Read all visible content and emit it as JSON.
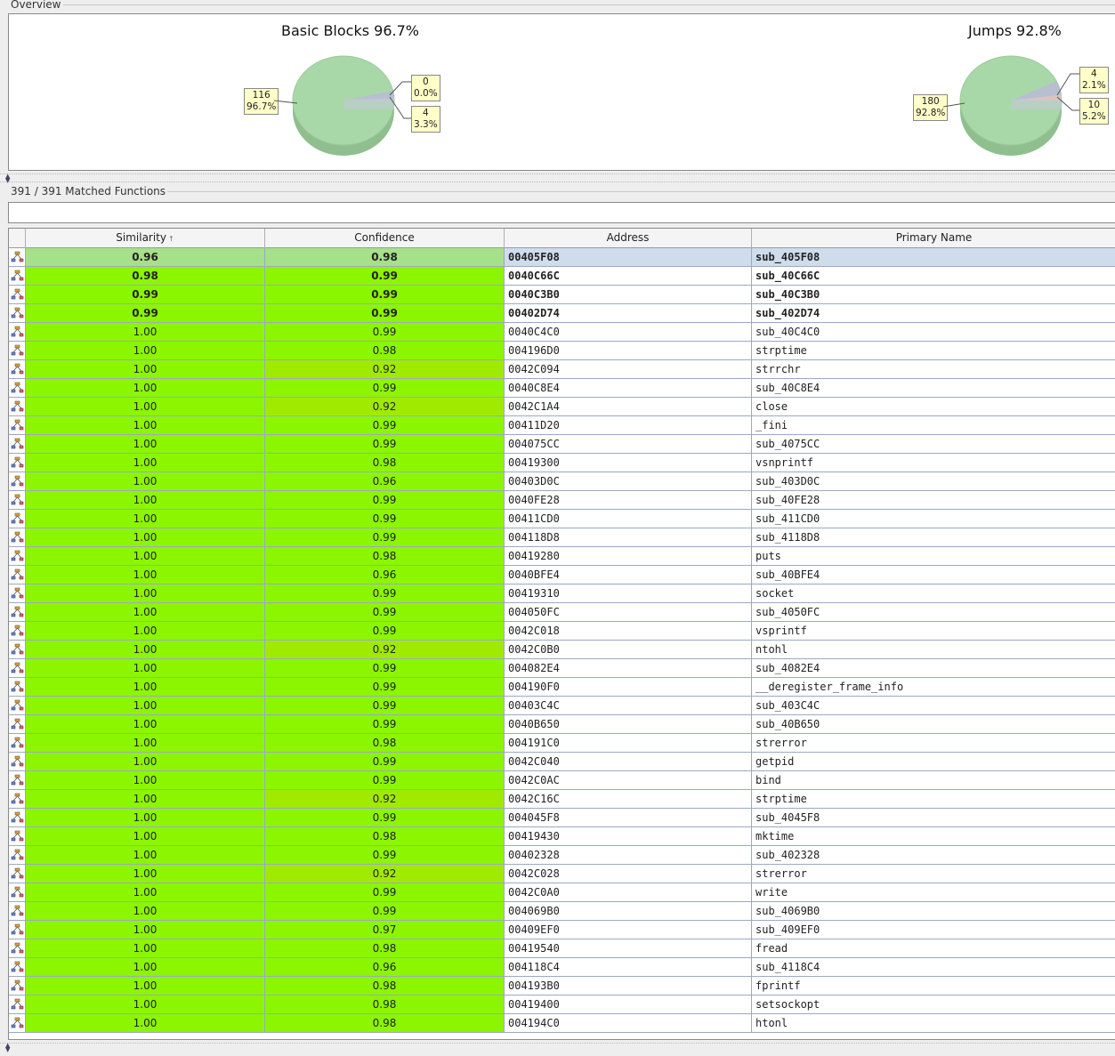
{
  "overview": {
    "title": "Overview",
    "charts": [
      {
        "title": "Basic Blocks 96.7%",
        "slices": [
          {
            "count": "116",
            "pct": "96.7%",
            "value": 116,
            "color": "#a8d8a8"
          },
          {
            "count": "0",
            "pct": "0.0%",
            "value": 0,
            "color": "#e8c8c8"
          },
          {
            "count": "4",
            "pct": "3.3%",
            "value": 4,
            "color": "#b8bcd4"
          }
        ]
      },
      {
        "title": "Jumps 92.8%",
        "slices": [
          {
            "count": "180",
            "pct": "92.8%",
            "value": 180,
            "color": "#a8d8a8"
          },
          {
            "count": "4",
            "pct": "2.1%",
            "value": 4,
            "color": "#e8c0c0"
          },
          {
            "count": "10",
            "pct": "5.2%",
            "value": 10,
            "color": "#b8bcd4"
          }
        ]
      }
    ]
  },
  "matched": {
    "title": "391 / 391 Matched Functions",
    "filter_value": "",
    "columns": {
      "similarity": "Similarity",
      "confidence": "Confidence",
      "address": "Address",
      "primary_name": "Primary Name"
    },
    "sort_indicator": "↑",
    "rows": [
      {
        "similarity": "0.96",
        "confidence": "0.98",
        "address": "00405F08",
        "name": "sub_405F08",
        "bold": true,
        "selected": true
      },
      {
        "similarity": "0.98",
        "confidence": "0.99",
        "address": "0040C66C",
        "name": "sub_40C66C",
        "bold": true
      },
      {
        "similarity": "0.99",
        "confidence": "0.99",
        "address": "0040C3B0",
        "name": "sub_40C3B0",
        "bold": true
      },
      {
        "similarity": "0.99",
        "confidence": "0.99",
        "address": "00402D74",
        "name": "sub_402D74",
        "bold": true
      },
      {
        "similarity": "1.00",
        "confidence": "0.99",
        "address": "0040C4C0",
        "name": "sub_40C4C0"
      },
      {
        "similarity": "1.00",
        "confidence": "0.98",
        "address": "004196D0",
        "name": "strptime"
      },
      {
        "similarity": "1.00",
        "confidence": "0.92",
        "address": "0042C094",
        "name": "strrchr"
      },
      {
        "similarity": "1.00",
        "confidence": "0.99",
        "address": "0040C8E4",
        "name": "sub_40C8E4"
      },
      {
        "similarity": "1.00",
        "confidence": "0.92",
        "address": "0042C1A4",
        "name": "close"
      },
      {
        "similarity": "1.00",
        "confidence": "0.99",
        "address": "00411D20",
        "name": "_fini"
      },
      {
        "similarity": "1.00",
        "confidence": "0.99",
        "address": "004075CC",
        "name": "sub_4075CC"
      },
      {
        "similarity": "1.00",
        "confidence": "0.98",
        "address": "00419300",
        "name": "vsnprintf"
      },
      {
        "similarity": "1.00",
        "confidence": "0.96",
        "address": "00403D0C",
        "name": "sub_403D0C"
      },
      {
        "similarity": "1.00",
        "confidence": "0.99",
        "address": "0040FE28",
        "name": "sub_40FE28"
      },
      {
        "similarity": "1.00",
        "confidence": "0.99",
        "address": "00411CD0",
        "name": "sub_411CD0"
      },
      {
        "similarity": "1.00",
        "confidence": "0.99",
        "address": "004118D8",
        "name": "sub_4118D8"
      },
      {
        "similarity": "1.00",
        "confidence": "0.98",
        "address": "00419280",
        "name": "puts"
      },
      {
        "similarity": "1.00",
        "confidence": "0.96",
        "address": "0040BFE4",
        "name": "sub_40BFE4"
      },
      {
        "similarity": "1.00",
        "confidence": "0.99",
        "address": "00419310",
        "name": "socket"
      },
      {
        "similarity": "1.00",
        "confidence": "0.99",
        "address": "004050FC",
        "name": "sub_4050FC"
      },
      {
        "similarity": "1.00",
        "confidence": "0.99",
        "address": "0042C018",
        "name": "vsprintf"
      },
      {
        "similarity": "1.00",
        "confidence": "0.92",
        "address": "0042C0B0",
        "name": "ntohl"
      },
      {
        "similarity": "1.00",
        "confidence": "0.99",
        "address": "004082E4",
        "name": "sub_4082E4"
      },
      {
        "similarity": "1.00",
        "confidence": "0.99",
        "address": "004190F0",
        "name": "__deregister_frame_info"
      },
      {
        "similarity": "1.00",
        "confidence": "0.99",
        "address": "00403C4C",
        "name": "sub_403C4C"
      },
      {
        "similarity": "1.00",
        "confidence": "0.99",
        "address": "0040B650",
        "name": "sub_40B650"
      },
      {
        "similarity": "1.00",
        "confidence": "0.98",
        "address": "004191C0",
        "name": "strerror"
      },
      {
        "similarity": "1.00",
        "confidence": "0.99",
        "address": "0042C040",
        "name": "getpid"
      },
      {
        "similarity": "1.00",
        "confidence": "0.99",
        "address": "0042C0AC",
        "name": "bind"
      },
      {
        "similarity": "1.00",
        "confidence": "0.92",
        "address": "0042C16C",
        "name": "strptime"
      },
      {
        "similarity": "1.00",
        "confidence": "0.99",
        "address": "004045F8",
        "name": "sub_4045F8"
      },
      {
        "similarity": "1.00",
        "confidence": "0.98",
        "address": "00419430",
        "name": "mktime"
      },
      {
        "similarity": "1.00",
        "confidence": "0.99",
        "address": "00402328",
        "name": "sub_402328"
      },
      {
        "similarity": "1.00",
        "confidence": "0.92",
        "address": "0042C028",
        "name": "strerror"
      },
      {
        "similarity": "1.00",
        "confidence": "0.99",
        "address": "0042C0A0",
        "name": "write"
      },
      {
        "similarity": "1.00",
        "confidence": "0.99",
        "address": "004069B0",
        "name": "sub_4069B0"
      },
      {
        "similarity": "1.00",
        "confidence": "0.97",
        "address": "00409EF0",
        "name": "sub_409EF0"
      },
      {
        "similarity": "1.00",
        "confidence": "0.98",
        "address": "00419540",
        "name": "fread"
      },
      {
        "similarity": "1.00",
        "confidence": "0.96",
        "address": "004118C4",
        "name": "sub_4118C4"
      },
      {
        "similarity": "1.00",
        "confidence": "0.98",
        "address": "004193B0",
        "name": "fprintf"
      },
      {
        "similarity": "1.00",
        "confidence": "0.98",
        "address": "00419400",
        "name": "setsockopt"
      },
      {
        "similarity": "1.00",
        "confidence": "0.98",
        "address": "004194C0",
        "name": "htonl"
      }
    ]
  },
  "colors": {
    "green_full": "#8cf500",
    "green_selected": "#a6e08a",
    "green_mid": "#a0ea00",
    "green_strong": "#84f000",
    "selection_blue": "#cfdcec"
  }
}
